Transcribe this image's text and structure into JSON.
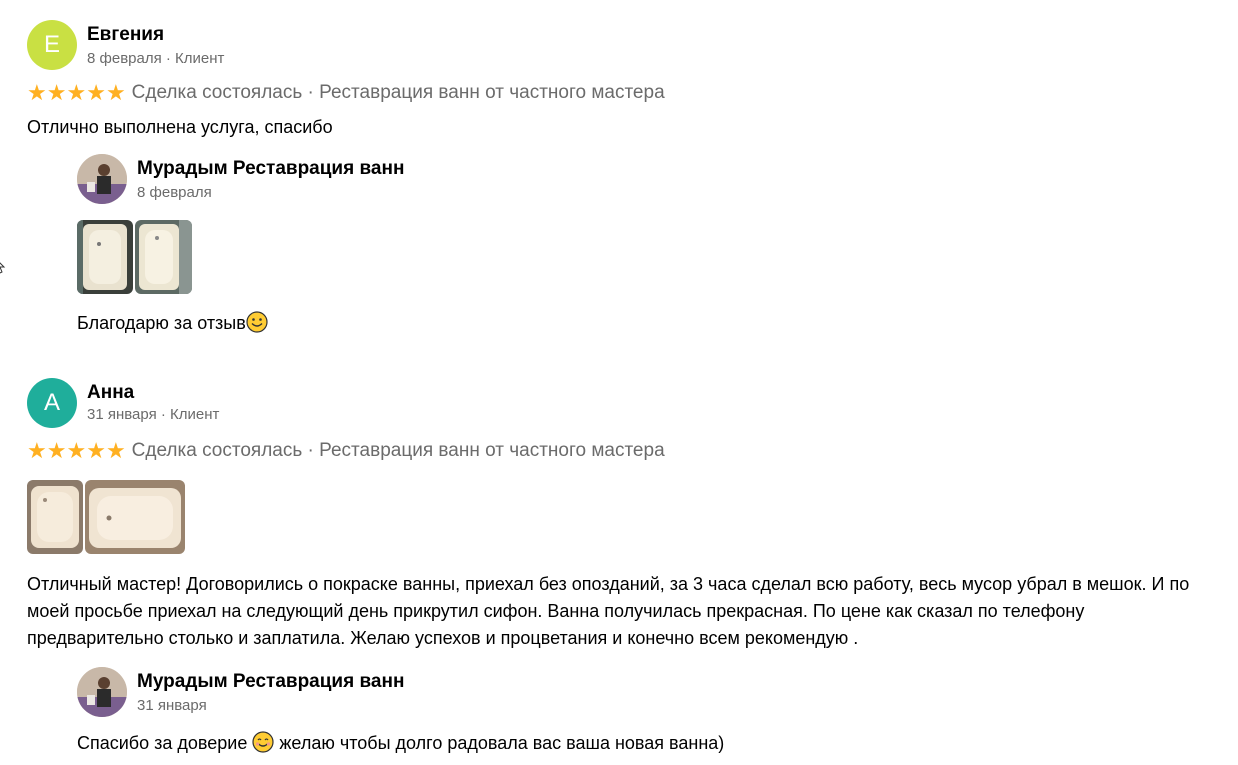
{
  "reviews": [
    {
      "avatar_letter": "Е",
      "avatar_color": "#c9e043",
      "name": "Евгения",
      "meta": "8 февраля · Клиент",
      "rating": 5,
      "deal": "Сделка состоялась · Реставрация ванн от частного мастера",
      "text": "Отлично выполнена услуга, спасибо",
      "reply": {
        "name": "Мурадым Реставрация ванн",
        "date": "8 февраля",
        "text": "Благодарю за отзыв"
      }
    },
    {
      "avatar_letter": "А",
      "avatar_color": "#1fae9b",
      "name": "Анна",
      "meta": "31 января · Клиент",
      "rating": 5,
      "deal": "Сделка состоялась · Реставрация ванн от частного мастера",
      "text": "Отличный мастер! Договорились о покраске ванны, приехал без опозданий, за 3 часа сделал всю работу, весь мусор убрал в мешок. И по моей просьбе приехал на следующий день прикрутил сифон. Ванна получилась прекрасная. По цене как сказал по телефону предварительно столько и заплатила. Желаю успехов и процветания и конечно всем рекомендую .",
      "reply": {
        "name": "Мурадым Реставрация ванн",
        "date": "31 января",
        "text_before": "Спасибо за доверие",
        "text_after": "желаю чтобы долго радовала вас ваша новая ванна)"
      }
    }
  ],
  "icons": {
    "star": "star-icon",
    "smile": "smile-emoji-icon",
    "cursor": "cursor-icon"
  },
  "colors": {
    "star": "#ffb021",
    "meta": "#6b6b6b"
  }
}
